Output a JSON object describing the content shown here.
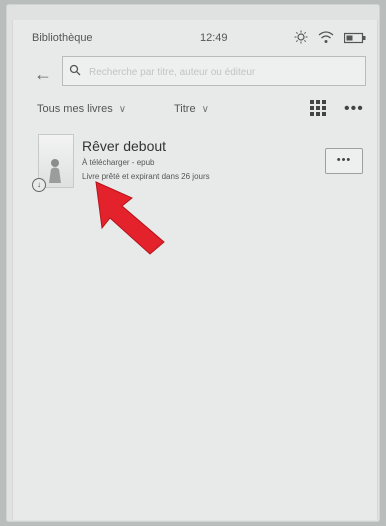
{
  "status_bar": {
    "left_label": "Bibliothèque",
    "time": "12:49",
    "icons": [
      "brightness-icon",
      "wifi-icon",
      "battery-icon"
    ]
  },
  "search": {
    "placeholder": "Recherche par titre, auteur ou éditeur"
  },
  "filters": {
    "collection": "Tous mes livres",
    "sort": "Titre"
  },
  "toolbar": {
    "more_label": "•••"
  },
  "books": [
    {
      "title": "Rêver debout",
      "meta": "À télécharger - epub",
      "status": "Livre prêté et expirant dans 26 jours",
      "more_label": "•••"
    }
  ],
  "colors": {
    "screen": "#e8eaea",
    "arrow": "#e4222b"
  }
}
